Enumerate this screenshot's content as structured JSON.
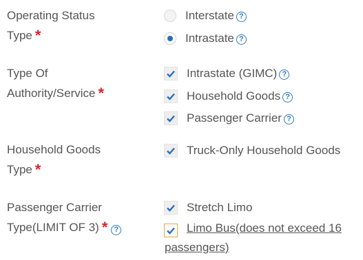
{
  "operating_status": {
    "label_line1": "Operating Status",
    "label_line2": "Type",
    "required": "*",
    "options": [
      {
        "label": "Interstate",
        "selected": false
      },
      {
        "label": "Intrastate",
        "selected": true
      }
    ]
  },
  "authority_service": {
    "label_line1": "Type Of",
    "label_line2": "Authority/Service",
    "required": "*",
    "options": [
      {
        "label": "Intrastate (GIMC)",
        "checked": true
      },
      {
        "label": "Household Goods",
        "checked": true
      },
      {
        "label": "Passenger Carrier",
        "checked": true
      }
    ]
  },
  "household_goods": {
    "label_line1": "Household Goods",
    "label_line2": "Type",
    "required": "*",
    "options": [
      {
        "label": "Truck-Only Household Goods",
        "checked": true
      }
    ]
  },
  "passenger_carrier": {
    "label_line1": "Passenger Carrier",
    "label_line2": "Type(LIMIT OF 3)",
    "required": "*",
    "options": [
      {
        "label": "Stretch Limo",
        "checked": true
      },
      {
        "label_line1": "Limo Bus(does not exceed 16",
        "label_line2": "passengers)",
        "checked": true
      }
    ]
  },
  "icons": {
    "help": "?"
  },
  "colors": {
    "accent": "#2a6ebf",
    "required": "#d4252c",
    "focus_border": "#e5a640"
  }
}
